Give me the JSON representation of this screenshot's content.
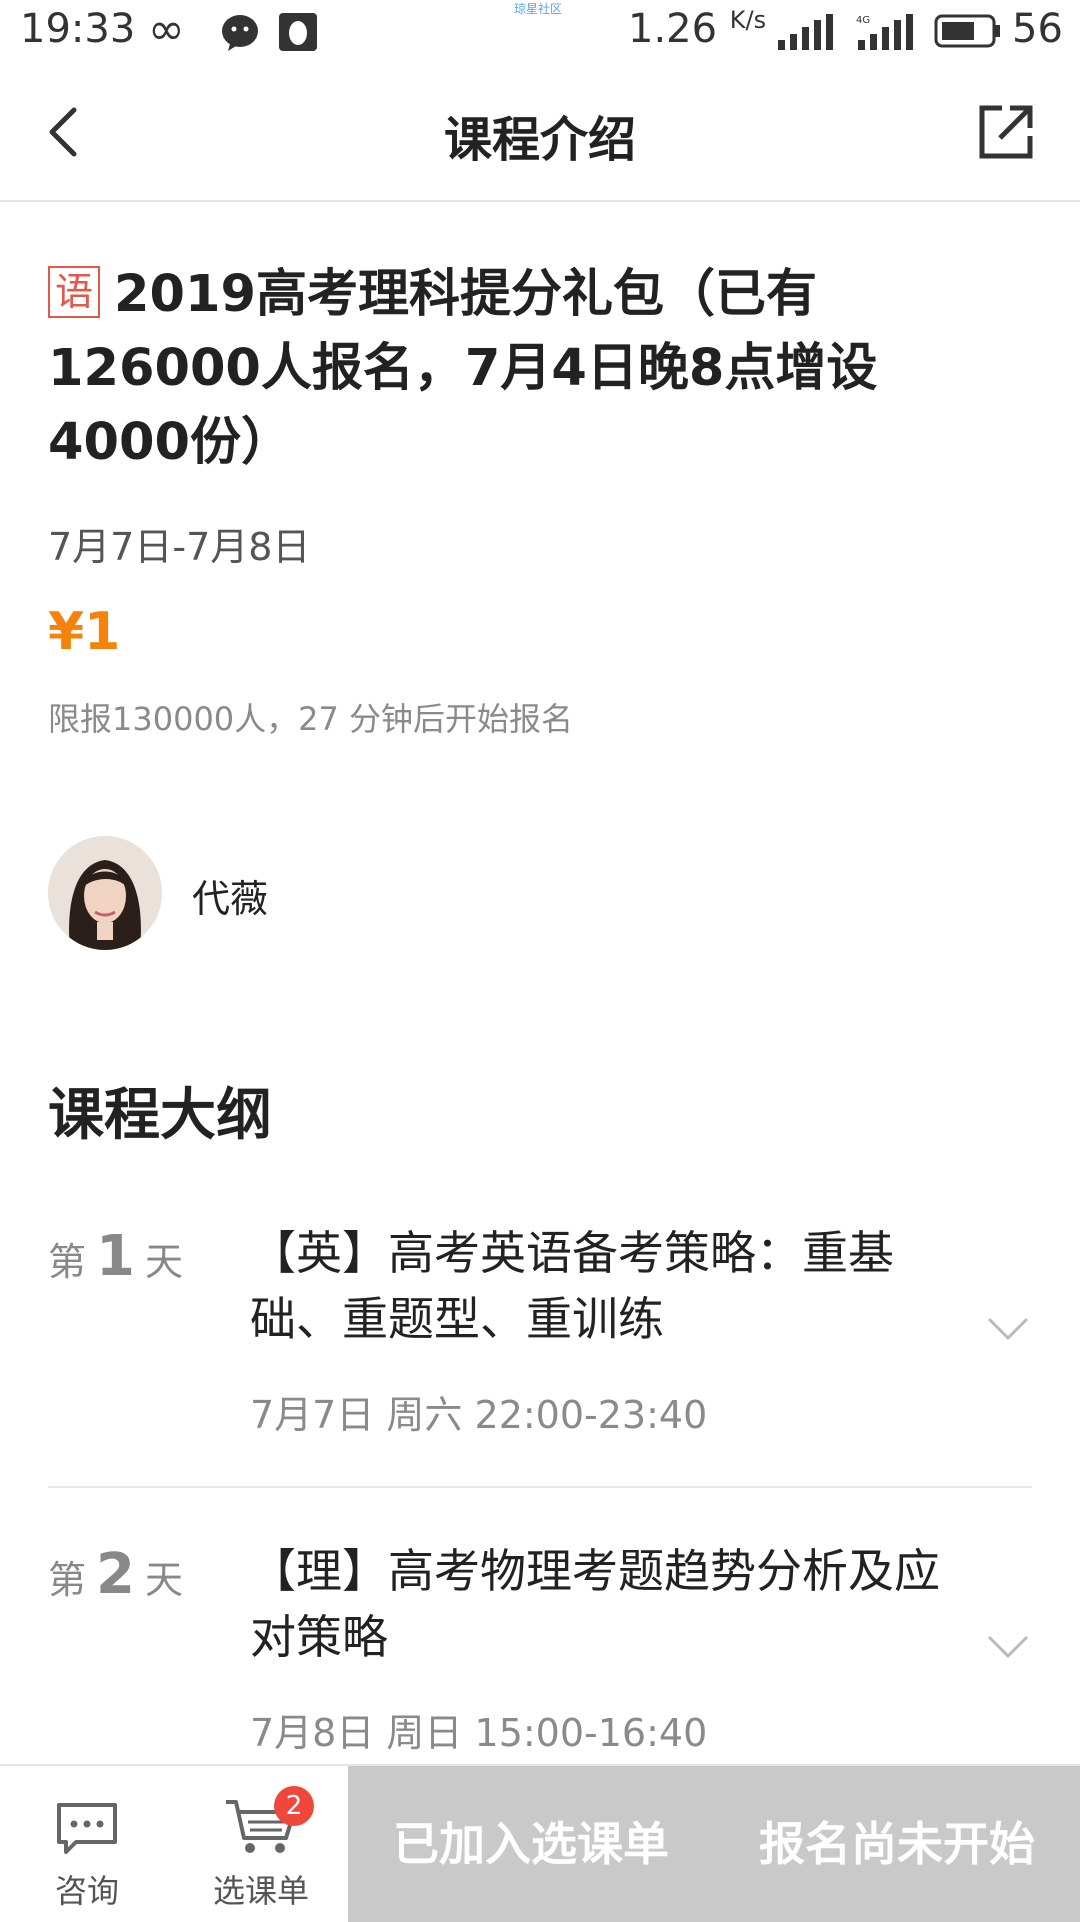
{
  "status_bar": {
    "time": "19:33",
    "infinity": "∞",
    "network_label": "琼星社区",
    "speed": "1.26",
    "speed_unit": "K/s",
    "battery": "56"
  },
  "header": {
    "title": "课程介绍"
  },
  "course": {
    "tag": "语",
    "title": "2019高考理科提分礼包（已有126000人报名，7月4日晚8点增设4000份）",
    "dates": "7月7日-7月8日",
    "price": "¥1",
    "limit": "限报130000人，27 分钟后开始报名"
  },
  "teacher": {
    "name": "代薇"
  },
  "outline": {
    "title": "课程大纲",
    "lessons": [
      {
        "day_prefix": "第",
        "day_num": "1",
        "day_suffix": "天",
        "title": "【英】高考英语备考策略：重基础、重题型、重训练",
        "time": "7月7日 周六 22:00-23:40"
      },
      {
        "day_prefix": "第",
        "day_num": "2",
        "day_suffix": "天",
        "title": "【理】高考物理考题趋势分析及应对策略",
        "time": "7月8日 周日 15:00-16:40"
      }
    ]
  },
  "bottom_bar": {
    "consult_label": "咨询",
    "cart_label": "选课单",
    "cart_badge": "2",
    "added_label": "已加入选课单",
    "signup_label": "报名尚未开始"
  },
  "colors": {
    "accent_orange": "#f5820b",
    "tag_red": "#e05a4a",
    "badge_red": "#f0473b",
    "disabled_gray": "#c9c9c9"
  }
}
